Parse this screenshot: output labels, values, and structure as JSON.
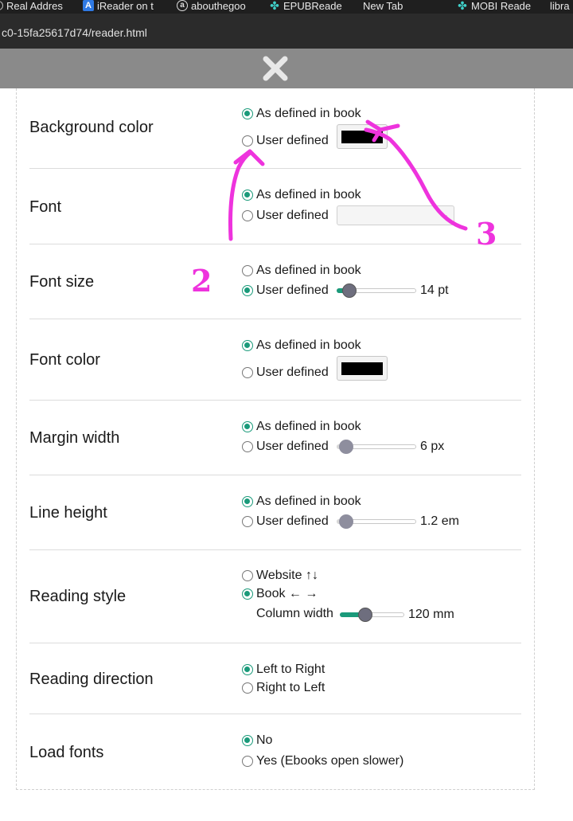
{
  "bookmarks": [
    {
      "label": "Real Addres",
      "icon": "globe-icon"
    },
    {
      "label": "iReader on t",
      "icon": "app-icon"
    },
    {
      "label": "abouthegoo",
      "icon": "at-sign-icon"
    },
    {
      "label": "EPUBReade",
      "icon": "puzzle-icon"
    },
    {
      "label": "New Tab",
      "icon": ""
    },
    {
      "label": "MOBI Reade",
      "icon": "puzzle-icon"
    },
    {
      "label": "libra",
      "icon": ""
    }
  ],
  "url": "c0-15fa25617d74/reader.html",
  "settings": {
    "background_color": {
      "label": "Background color",
      "opt1": "As defined in book",
      "opt2": "User defined",
      "selected": "opt1",
      "color": "#000000"
    },
    "font": {
      "label": "Font",
      "opt1": "As defined in book",
      "opt2": "User defined",
      "selected": "opt1",
      "select_value": ""
    },
    "font_size": {
      "label": "Font size",
      "opt1": "As defined in book",
      "opt2": "User defined",
      "selected": "opt2",
      "value_text": "14 pt"
    },
    "font_color": {
      "label": "Font color",
      "opt1": "As defined in book",
      "opt2": "User defined",
      "selected": "opt1",
      "color": "#000000"
    },
    "margin_width": {
      "label": "Margin width",
      "opt1": "As defined in book",
      "opt2": "User defined",
      "selected": "opt1",
      "value_text": "6 px"
    },
    "line_height": {
      "label": "Line height",
      "opt1": "As defined in book",
      "opt2": "User defined",
      "selected": "opt1",
      "value_text": "1.2 em"
    },
    "reading_style": {
      "label": "Reading style",
      "opt1": "Website ↑↓",
      "opt2": "Book ← →",
      "selected": "opt2",
      "column_label": "Column width",
      "column_value": "120 mm"
    },
    "reading_direction": {
      "label": "Reading direction",
      "opt1": "Left to Right",
      "opt2": "Right to Left",
      "selected": "opt1"
    },
    "load_fonts": {
      "label": "Load fonts",
      "opt1": "No",
      "opt2": "Yes (Ebooks open slower)",
      "selected": "opt1"
    }
  },
  "annotations": {
    "num2": "2",
    "num3": "3",
    "color": "#ee33dd"
  },
  "accent_color": "#1a9a7a"
}
